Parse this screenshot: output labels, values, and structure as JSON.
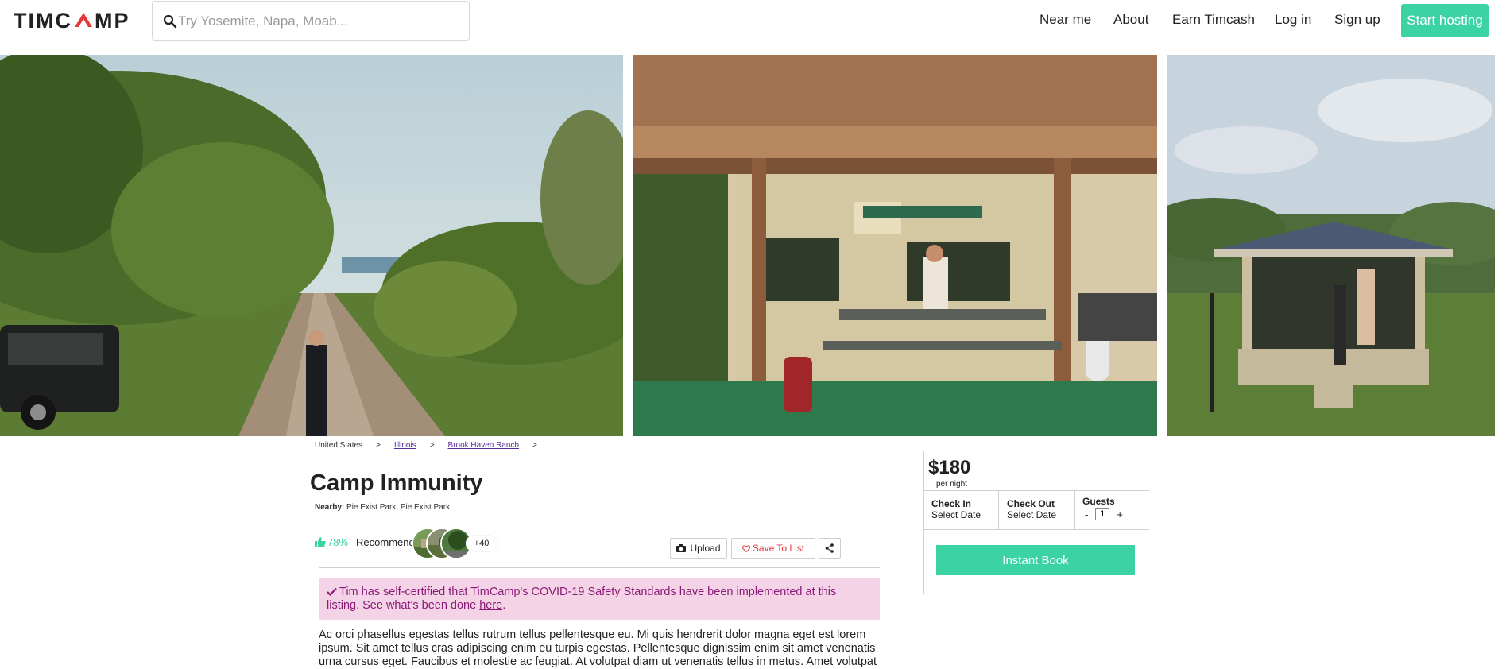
{
  "header": {
    "logo_text_left": "TIMC",
    "logo_text_right": "MP",
    "search_placeholder": "Try Yosemite, Napa, Moab...",
    "nav": [
      "Near me",
      "About",
      "Earn Timcash",
      "Log in",
      "Sign up"
    ],
    "cta": "Start hosting"
  },
  "breadcrumb": {
    "items": [
      {
        "label": "United States",
        "link": false
      },
      {
        "label": "Illinois",
        "link": true
      },
      {
        "label": "Brook Haven Ranch",
        "link": true
      }
    ],
    "separator": ">"
  },
  "listing": {
    "title": "Camp Immunity",
    "nearby_label": "Nearby:",
    "nearby_value": "Pie Exist Park, Pie Exist Park",
    "recommend_pct": "78%",
    "recommend_label": "Recommend",
    "avatar_more": "+40",
    "upload_label": "Upload",
    "save_label": "Save To List",
    "covid_text": "Tim has self-certified that TimCamp's COVID-19 Safety Standards have been implemented at this listing. See what's been done",
    "covid_link": "here",
    "description": "Ac orci phasellus egestas tellus rutrum tellus pellentesque eu. Mi quis hendrerit dolor magna eget est lorem ipsum. Sit amet tellus cras adipiscing enim eu turpis egestas. Pellentesque dignissim enim sit amet venenatis urna cursus eget. Faucibus et molestie ac feugiat. At volutpat diam ut venenatis tellus in metus. Amet volutpat"
  },
  "booking": {
    "price": "$180",
    "per_night": "per night",
    "check_in_label": "Check In",
    "check_in_value": "Select Date",
    "check_out_label": "Check Out",
    "check_out_value": "Select Date",
    "guests_label": "Guests",
    "guests_value": "1",
    "minus": "-",
    "plus": "+",
    "instant_book": "Instant Book"
  },
  "colors": {
    "accent": "#3cd3a4",
    "logo_red": "#e5383b",
    "covid_bg": "#f5d3e6",
    "covid_text": "#8a1a78",
    "link_purple": "#5a2ca0"
  },
  "icons": [
    "search-icon",
    "camera-icon",
    "thumbs-up-icon",
    "check-icon",
    "heart-icon",
    "share-icon"
  ]
}
